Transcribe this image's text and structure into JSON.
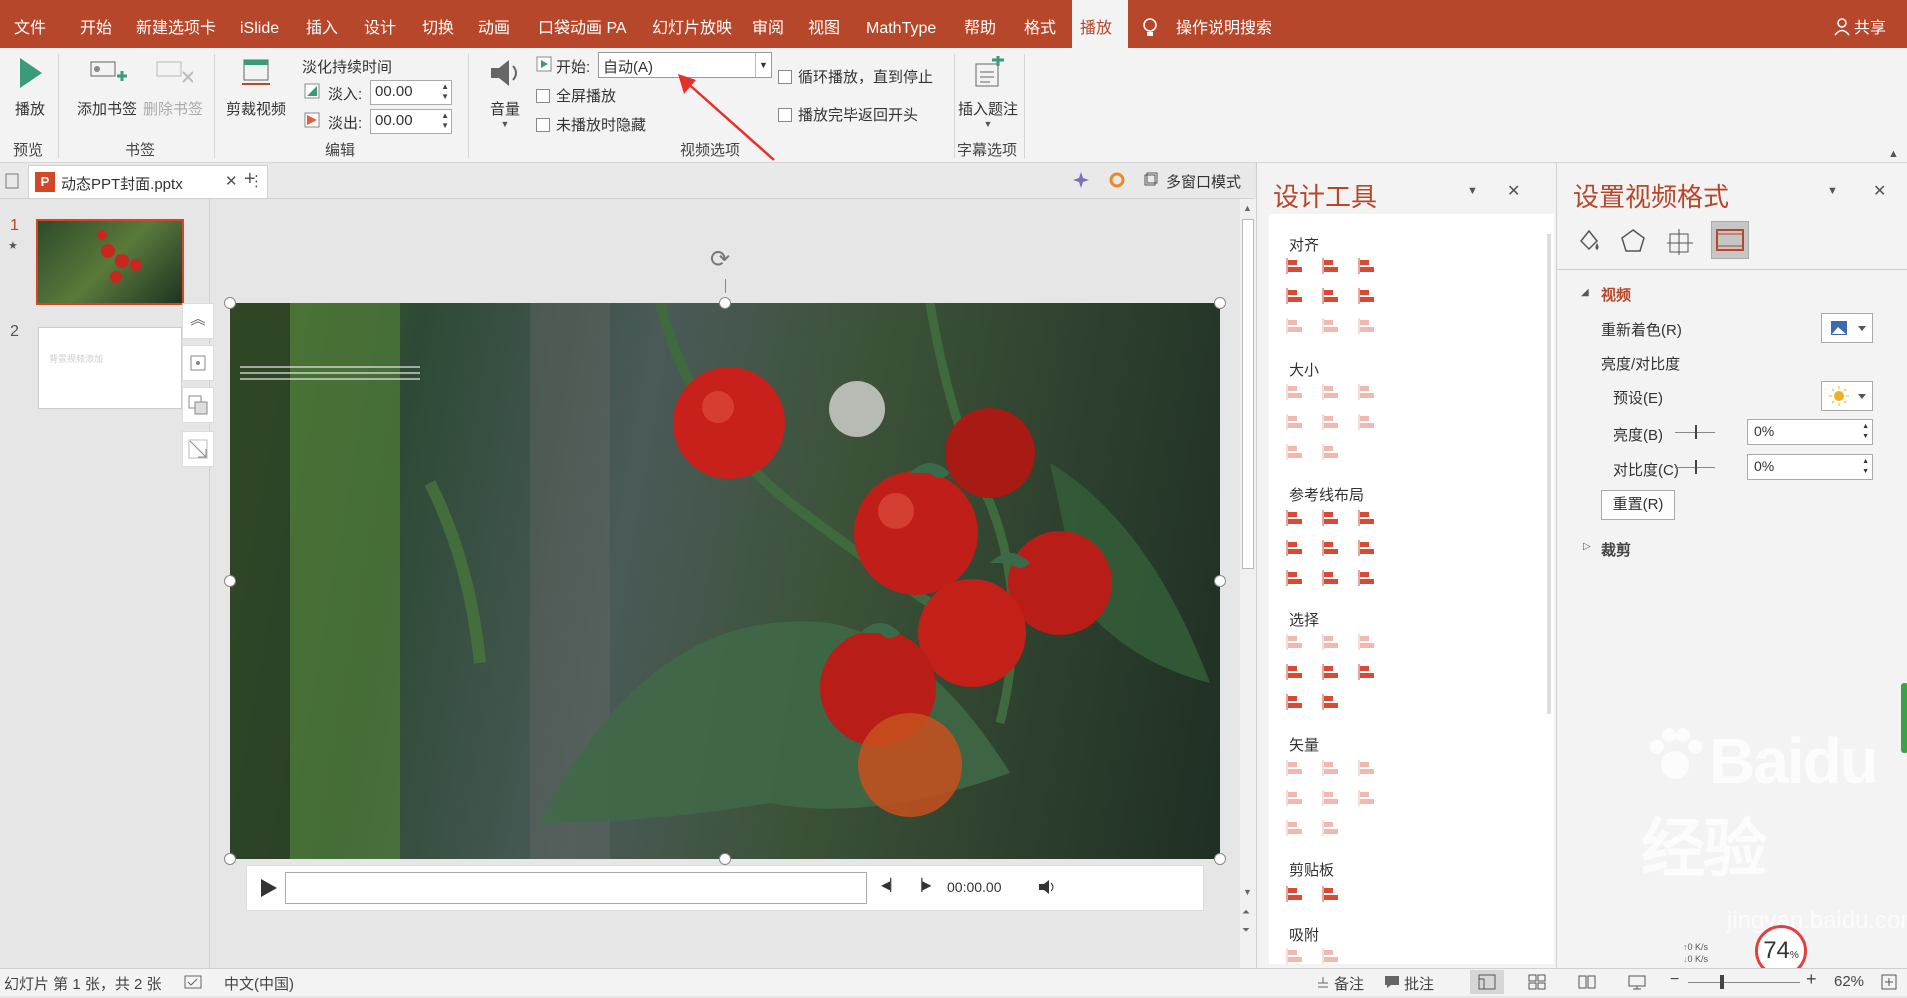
{
  "menu_tabs": [
    "文件",
    "开始",
    "新建选项卡",
    "iSlide",
    "插入",
    "设计",
    "切换",
    "动画",
    "口袋动画 PA",
    "幻灯片放映",
    "审阅",
    "视图",
    "MathType",
    "帮助",
    "格式",
    "播放"
  ],
  "tell_me": "操作说明搜索",
  "share": "共享",
  "ribbon": {
    "preview": {
      "play": "播放",
      "group": "预览"
    },
    "bookmarks": {
      "add": "添加书签",
      "remove": "删除书签",
      "group": "书签"
    },
    "edit": {
      "trim": "剪裁视频",
      "fade_title": "淡化持续时间",
      "fade_in_label": "淡入:",
      "fade_in_value": "00.00",
      "fade_out_label": "淡出:",
      "fade_out_value": "00.00",
      "group": "编辑"
    },
    "video_options": {
      "volume": "音量",
      "start_label": "开始:",
      "start_value": "自动(A)",
      "fullscreen": "全屏播放",
      "hide": "未播放时隐藏",
      "loop": "循环播放，直到停止",
      "rewind": "播放完毕返回开头",
      "group": "视频选项"
    },
    "captions": {
      "insert": "插入题注",
      "group": "字幕选项"
    }
  },
  "doc_tab": {
    "name": "动态PPT封面.pptx",
    "multiwindow": "多窗口模式"
  },
  "thumbnails": {
    "slide1": {
      "num": "1",
      "star": "★"
    },
    "slide2": {
      "num": "2",
      "text": "背景视频添加"
    }
  },
  "player": {
    "time": "00:00.00"
  },
  "design_tools": {
    "title": "设计工具",
    "sections": [
      "对齐",
      "大小",
      "参考线布局",
      "选择",
      "矢量",
      "剪贴板",
      "吸附"
    ]
  },
  "format_pane": {
    "title": "设置视频格式",
    "video_section": "视频",
    "recolor": "重新着色(R)",
    "brightness_contrast": "亮度/对比度",
    "presets": "预设(E)",
    "brightness": "亮度(B)",
    "brightness_value": "0%",
    "contrast": "对比度(C)",
    "contrast_value": "0%",
    "reset": "重置(R)",
    "crop": "裁剪"
  },
  "status": {
    "slide_info": "幻灯片 第 1 张，共 2 张",
    "language": "中文(中国)",
    "notes": "备注",
    "comments": "批注",
    "zoom": "62%",
    "net_up": "0  K/s",
    "net_down": "0  K/s",
    "percent": "74"
  },
  "watermark": {
    "brand": "Baidu经验",
    "url": "jingyan.baidu.com"
  },
  "colors": {
    "accent": "#b7472a",
    "tab_text": "#ffffff"
  }
}
